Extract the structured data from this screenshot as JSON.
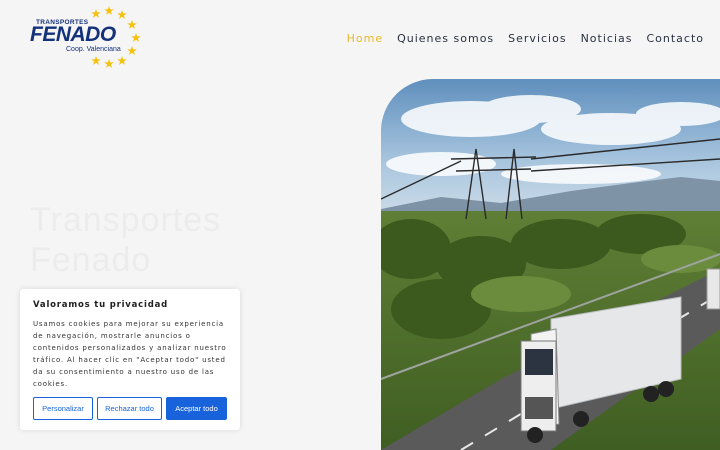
{
  "logo": {
    "top_text": "TRANSPORTES",
    "brand": "FENADO",
    "sub_text": "Coop. Valenciana",
    "star_color": "#f4c20d",
    "brand_color": "#14327a"
  },
  "nav": {
    "items": [
      {
        "label": "Home",
        "active": true
      },
      {
        "label": "Quienes somos",
        "active": false
      },
      {
        "label": "Servicios",
        "active": false
      },
      {
        "label": "Noticias",
        "active": false
      },
      {
        "label": "Contacto",
        "active": false
      }
    ],
    "active_color": "#e8b829"
  },
  "hero": {
    "title_line1": "Transportes",
    "title_line2": "Fenado",
    "image_icon": "truck-highway-image"
  },
  "cookie": {
    "title": "Valoramos tu privacidad",
    "body": "Usamos cookies para mejorar su experiencia de navegación, mostrarle anuncios o contenidos personalizados y analizar nuestro tráfico. Al hacer clic en \"Aceptar todo\" usted da su consentimiento a nuestro uso de las cookies.",
    "personalize_label": "Personalizar",
    "reject_label": "Rechazar todo",
    "accept_label": "Aceptar todo",
    "accent_color": "#1863dc"
  }
}
